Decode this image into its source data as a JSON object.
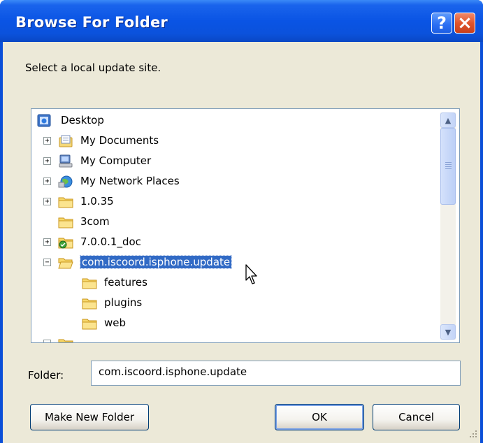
{
  "window": {
    "title": "Browse For Folder"
  },
  "titlebar_buttons": {
    "help": "?",
    "close": "×"
  },
  "prompt": "Select a local update site.",
  "tree": {
    "items": [
      {
        "label": "Desktop",
        "icon": "desktop-icon",
        "expander": ""
      },
      {
        "label": "My Documents",
        "icon": "documents-icon",
        "expander": "+"
      },
      {
        "label": "My Computer",
        "icon": "computer-icon",
        "expander": "+"
      },
      {
        "label": "My Network Places",
        "icon": "network-icon",
        "expander": "+"
      },
      {
        "label": "1.0.35",
        "icon": "folder-icon",
        "expander": "+"
      },
      {
        "label": "3com",
        "icon": "folder-icon",
        "expander": ""
      },
      {
        "label": "7.0.0.1_doc",
        "icon": "shared-folder-icon",
        "expander": "+"
      },
      {
        "label": "com.iscoord.isphone.update",
        "icon": "open-folder-icon",
        "expander": "−",
        "selected": true
      },
      {
        "label": "features",
        "icon": "folder-icon",
        "expander": ""
      },
      {
        "label": "plugins",
        "icon": "folder-icon",
        "expander": ""
      },
      {
        "label": "web",
        "icon": "folder-icon",
        "expander": ""
      }
    ]
  },
  "scrollbar": {
    "up": "▲",
    "down": "▼"
  },
  "folder": {
    "label": "Folder:",
    "value": "com.iscoord.isphone.update"
  },
  "buttons": {
    "make_new_folder": "Make New Folder",
    "ok": "OK",
    "cancel": "Cancel"
  },
  "colors": {
    "titlebar": "#0a54e4",
    "selection": "#316ac5",
    "dialog_face": "#ece9d8",
    "close_button": "#e0542c"
  }
}
